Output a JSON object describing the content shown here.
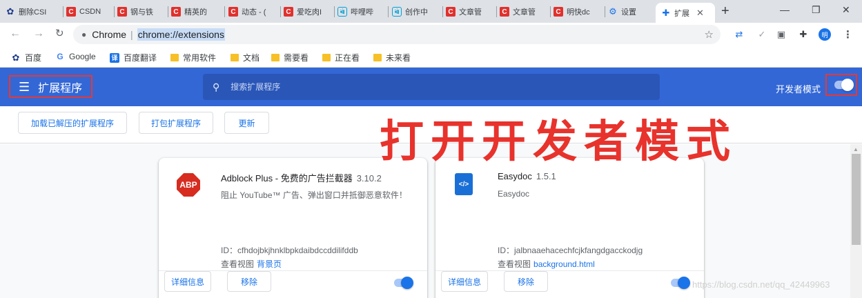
{
  "browser": {
    "tabs": [
      {
        "icon": "flower-icon",
        "title": "删除CSI"
      },
      {
        "icon": "csdn-icon",
        "title": "CSDN"
      },
      {
        "icon": "csdn-icon",
        "title": "钢与铁"
      },
      {
        "icon": "csdn-icon",
        "title": "精英的"
      },
      {
        "icon": "csdn-icon",
        "title": "动态 - ("
      },
      {
        "icon": "csdn-icon",
        "title": "爱吃肉I"
      },
      {
        "icon": "bilibili-icon",
        "title": "哔哩哔"
      },
      {
        "icon": "bilibili-icon",
        "title": "创作中"
      },
      {
        "icon": "csdn-icon",
        "title": "文章管"
      },
      {
        "icon": "csdn-icon",
        "title": "文章管"
      },
      {
        "icon": "csdn-icon",
        "title": "明快dc"
      },
      {
        "icon": "gear-icon",
        "title": "设置"
      }
    ],
    "active_tab": {
      "icon": "puzzle-icon",
      "title": "扩展"
    },
    "omnibox": {
      "origin": "Chrome",
      "url": "chrome://extensions"
    },
    "profile_initial": "明"
  },
  "bookmarks": [
    {
      "icon": "baidu-icon",
      "label": "百度"
    },
    {
      "icon": "google-icon",
      "label": "Google"
    },
    {
      "icon": "translate-icon",
      "label": "百度翻译"
    },
    {
      "icon": "folder-icon",
      "label": "常用软件"
    },
    {
      "icon": "folder-icon",
      "label": "文档"
    },
    {
      "icon": "folder-icon",
      "label": "需要看"
    },
    {
      "icon": "folder-icon",
      "label": "正在看"
    },
    {
      "icon": "folder-icon",
      "label": "未来看"
    }
  ],
  "header": {
    "title": "扩展程序",
    "search_placeholder": "搜索扩展程序",
    "dev_mode_label": "开发者模式",
    "dev_mode_on": true
  },
  "actions": {
    "load_unpacked": "加载已解压的扩展程序",
    "pack": "打包扩展程序",
    "update": "更新"
  },
  "annotation": "打开开发者模式",
  "extensions": [
    {
      "name": "Adblock Plus - 免费的广告拦截器",
      "version": "3.10.2",
      "description": "阻止 YouTube™ 广告、弹出窗口并抵御恶意软件！",
      "id": "ID：cfhdojbkjhnklbpkdaibdccddilifddb",
      "views_label": "查看视图",
      "views_link": "背景页",
      "icon_text": "ABP",
      "details_label": "详细信息",
      "remove_label": "移除",
      "enabled": true
    },
    {
      "name": "Easydoc",
      "version": "1.5.1",
      "description": "Easydoc",
      "id": "ID：jalbnaaehacechfcjkfangdgacckodjg",
      "views_label": "查看视图",
      "views_link": "background.html",
      "icon_text": "</>",
      "details_label": "详细信息",
      "remove_label": "移除",
      "enabled": true
    }
  ],
  "watermark": "https://blog.csdn.net/qq_42449963",
  "colors": {
    "header_bg": "#3367d6",
    "accent": "#1a73e8",
    "annotation_red": "#e8322c",
    "highlight_box": "#e53935"
  }
}
